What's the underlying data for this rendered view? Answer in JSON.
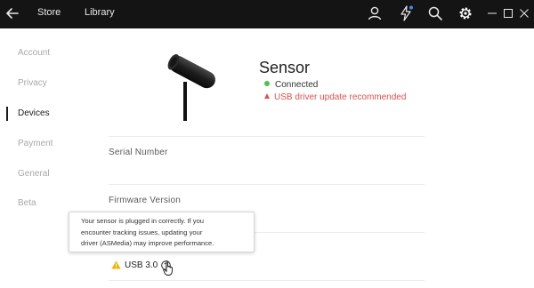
{
  "topbar": {
    "back_icon": "arrow-left-icon",
    "nav": [
      {
        "label": "Store"
      },
      {
        "label": "Library"
      }
    ],
    "icons": [
      "user-icon",
      "lightning-icon",
      "search-icon",
      "gear-icon"
    ],
    "notification_color": "#3b8eea",
    "window_icons": [
      "minimize-icon",
      "maximize-icon",
      "close-icon"
    ]
  },
  "sidebar": {
    "items": [
      {
        "label": "Account"
      },
      {
        "label": "Privacy"
      },
      {
        "label": "Devices"
      },
      {
        "label": "Payment"
      },
      {
        "label": "General"
      },
      {
        "label": "Beta"
      }
    ],
    "active": "Devices"
  },
  "device": {
    "name": "Sensor",
    "status_connected": "Connected",
    "status_warning": "USB driver update recommended",
    "connected_color": "#4cc14e",
    "warning_color": "#d9534f"
  },
  "fields": {
    "serial_label": "Serial Number",
    "firmware_label": "Firmware Version"
  },
  "usb": {
    "label": "USB 3.0",
    "warning_color": "#f0b400"
  },
  "tooltip": {
    "line1": "Your sensor is plugged in correctly. If you",
    "line2": "encounter tracking issues, updating your",
    "line3": "driver (ASMedia) may improve performance."
  }
}
